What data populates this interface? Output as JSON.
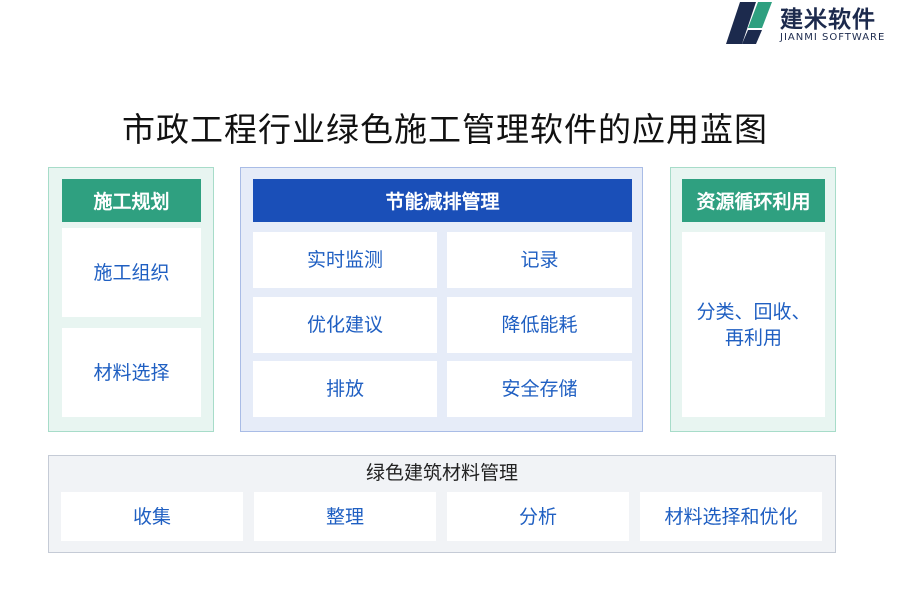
{
  "logo": {
    "name_cn": "建米软件",
    "name_en": "JIANMI SOFTWARE",
    "icon": "jianmi-logo-icon",
    "colors": {
      "dark": "#1c2a4d",
      "accent": "#2fa080"
    }
  },
  "title": "市政工程行业绿色施工管理软件的应用蓝图",
  "left_panel": {
    "header": "施工规划",
    "items": [
      "施工组织",
      "材料选择"
    ]
  },
  "center_panel": {
    "header": "节能减排管理",
    "items": [
      "实时监测",
      "记录",
      "优化建议",
      "降低能耗",
      "排放",
      "安全存储"
    ]
  },
  "right_panel": {
    "header": "资源循环利用",
    "item_line1": "分类、回收、",
    "item_line2": "再利用"
  },
  "bottom_panel": {
    "header": "绿色建筑材料管理",
    "items": [
      "收集",
      "整理",
      "分析",
      "材料选择和优化"
    ]
  },
  "colors": {
    "green_header": "#2fa080",
    "blue_header": "#1a4fb8",
    "cell_text": "#1f5fc2"
  }
}
